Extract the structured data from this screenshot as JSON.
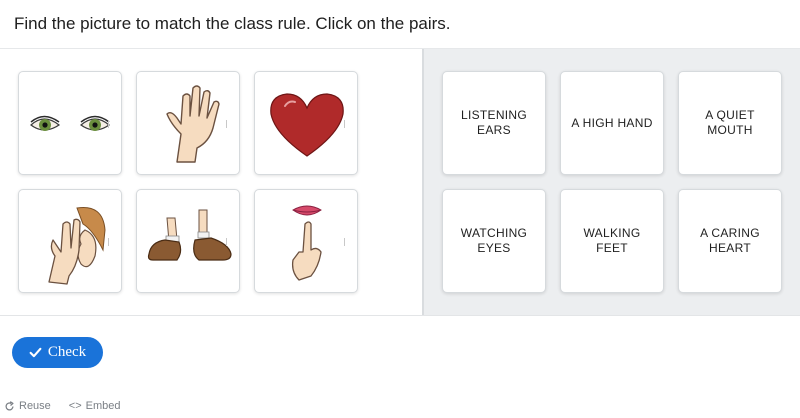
{
  "instruction": "Find the picture to match the class rule. Click on the pairs.",
  "image_cards": [
    {
      "name": "eyes-image",
      "icon": "eyes-icon"
    },
    {
      "name": "raised-hand-image",
      "icon": "raised-hand-icon"
    },
    {
      "name": "heart-image",
      "icon": "heart-icon"
    },
    {
      "name": "ear-image",
      "icon": "ear-icon"
    },
    {
      "name": "walking-feet-image",
      "icon": "walking-feet-icon"
    },
    {
      "name": "quiet-mouth-image",
      "icon": "quiet-mouth-icon"
    }
  ],
  "text_cards": [
    {
      "label": "LISTENING EARS"
    },
    {
      "label": "A HIGH HAND"
    },
    {
      "label": "A QUIET MOUTH"
    },
    {
      "label": "WATCHING EYES"
    },
    {
      "label": "WALKING FEET"
    },
    {
      "label": "A CARING HEART"
    }
  ],
  "check_button": {
    "label": "Check",
    "icon": "checkmark-icon",
    "color": "#1a73d9"
  },
  "footer": {
    "reuse_label": "Reuse",
    "embed_label": "Embed",
    "embed_icon_text": "<>"
  },
  "colors": {
    "right_panel_bg": "#eceef0",
    "heart": "#b02a2a"
  }
}
